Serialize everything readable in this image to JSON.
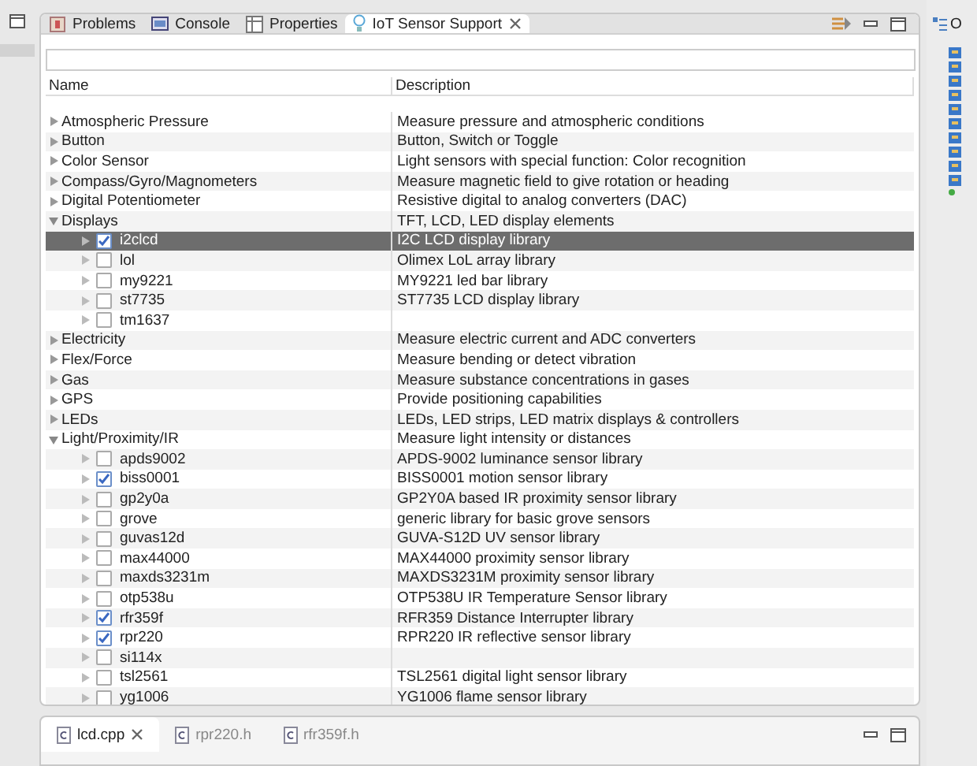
{
  "tabs": [
    {
      "label": "Problems",
      "selected": false,
      "closable": false
    },
    {
      "label": "Console",
      "selected": false,
      "closable": false
    },
    {
      "label": "Properties",
      "selected": false,
      "closable": false
    },
    {
      "label": "IoT Sensor Support",
      "selected": true,
      "closable": true
    }
  ],
  "table": {
    "columns": [
      "Name",
      "Description"
    ],
    "rows": [
      {
        "name": "Atmospheric Pressure",
        "description": "Measure pressure and atmospheric conditions",
        "expanded": false
      },
      {
        "name": "Button",
        "description": "Button, Switch or Toggle",
        "expanded": false
      },
      {
        "name": "Color Sensor",
        "description": "Light sensors with special function: Color recognition",
        "expanded": false
      },
      {
        "name": "Compass/Gyro/Magnometers",
        "description": "Measure magnetic field to give rotation or heading",
        "expanded": false
      },
      {
        "name": "Digital Potentiometer",
        "description": "Resistive digital to analog converters (DAC)",
        "expanded": false
      },
      {
        "name": "Displays",
        "description": "TFT, LCD, LED display elements",
        "expanded": true,
        "children": [
          {
            "name": "i2clcd",
            "description": "I2C LCD display library",
            "checked": true,
            "selected": true
          },
          {
            "name": "lol",
            "description": "Olimex LoL array library",
            "checked": false,
            "selected": false
          },
          {
            "name": "my9221",
            "description": "MY9221 led bar library",
            "checked": false,
            "selected": false
          },
          {
            "name": "st7735",
            "description": "ST7735 LCD display library",
            "checked": false,
            "selected": false
          },
          {
            "name": "tm1637",
            "checked": false,
            "selected": false
          }
        ]
      },
      {
        "name": "Electricity",
        "description": "Measure electric current and ADC converters",
        "expanded": false
      },
      {
        "name": "Flex/Force",
        "description": "Measure bending or detect vibration",
        "expanded": false
      },
      {
        "name": "Gas",
        "description": "Measure substance concentrations in gases",
        "expanded": false
      },
      {
        "name": "GPS",
        "description": "Provide positioning capabilities",
        "expanded": false
      },
      {
        "name": "LEDs",
        "description": "LEDs, LED strips, LED matrix displays & controllers",
        "expanded": false
      },
      {
        "name": "Light/Proximity/IR",
        "description": "Measure light intensity or distances",
        "expanded": true,
        "children": [
          {
            "name": "apds9002",
            "description": "APDS-9002 luminance sensor library",
            "checked": false,
            "selected": false
          },
          {
            "name": "biss0001",
            "description": "BISS0001 motion sensor library",
            "checked": true,
            "selected": false
          },
          {
            "name": "gp2y0a",
            "description": "GP2Y0A based IR proximity sensor library",
            "checked": false,
            "selected": false
          },
          {
            "name": "grove",
            "description": "generic library for basic grove sensors",
            "checked": false,
            "selected": false
          },
          {
            "name": "guvas12d",
            "description": "GUVA-S12D UV sensor library",
            "checked": false,
            "selected": false
          },
          {
            "name": "max44000",
            "description": "MAX44000 proximity sensor library",
            "checked": false,
            "selected": false
          },
          {
            "name": "maxds3231m",
            "description": "MAXDS3231M proximity sensor library",
            "checked": false,
            "selected": false
          },
          {
            "name": "otp538u",
            "description": "OTP538U IR Temperature Sensor library",
            "checked": false,
            "selected": false
          },
          {
            "name": "rfr359f",
            "description": "RFR359 Distance Interrupter library",
            "checked": true,
            "selected": false
          },
          {
            "name": "rpr220",
            "description": "RPR220 IR reflective sensor library",
            "checked": true,
            "selected": false
          },
          {
            "name": "si114x",
            "checked": false,
            "selected": false
          },
          {
            "name": "tsl2561",
            "description": "TSL2561 digital light sensor library",
            "checked": false,
            "selected": false
          },
          {
            "name": "yg1006",
            "description": "YG1006 flame sensor library",
            "checked": false,
            "selected": false
          }
        ]
      }
    ]
  },
  "editor_tabs": [
    {
      "label": "lcd.cpp",
      "selected": true,
      "closable": true
    },
    {
      "label": "rpr220.h",
      "selected": false,
      "closable": false
    },
    {
      "label": "rfr359f.h",
      "selected": false,
      "closable": false
    }
  ],
  "side_tab": {
    "label": "O"
  }
}
